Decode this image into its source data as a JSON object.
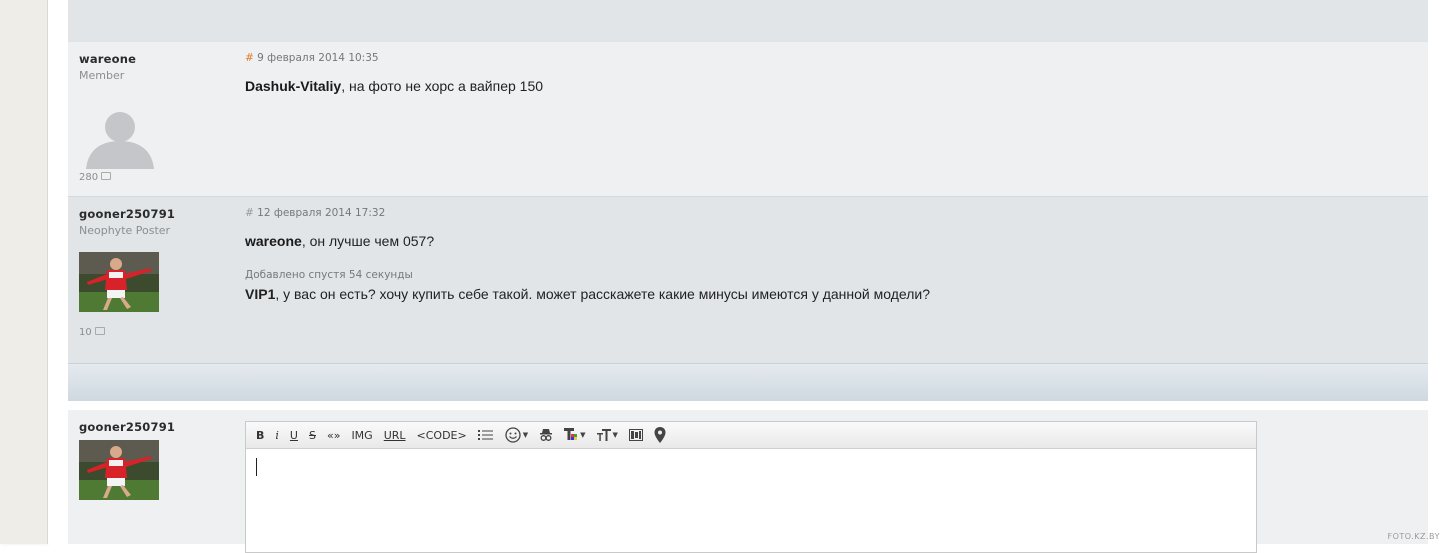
{
  "posts": [
    {
      "username": "wareone",
      "rank": "Member",
      "message_count": "280",
      "date": "9 февраля 2014 10:35",
      "quote_name": "Dashuk-Vitaliy",
      "text": ", на фото не хорс а вайпер 150"
    },
    {
      "username": "gooner250791",
      "rank": "Neophyte Poster",
      "message_count": "10",
      "date": "12 февраля 2014 17:32",
      "quote_name": "wareone",
      "text": ", он лучше чем 057?",
      "added_label": "Добавлено спустя 54 секунды",
      "quote_name2": "VIP1",
      "text2": ", у вас он есть? хочу купить себе такой. может расскажете какие минусы имеются у данной модели?"
    }
  ],
  "hash_symbol": "#",
  "reply": {
    "username": "gooner250791",
    "toolbar": {
      "bold": "B",
      "italic": "i",
      "underline": "U",
      "strike": "S",
      "quote": "«»",
      "img": "IMG",
      "url": "URL",
      "code": "<CODE>"
    }
  },
  "watermark": "FOTO.KZ.BY",
  "colors": {
    "hash_accent": "#e07b2a",
    "post_bg_light": "#eff0f2",
    "post_bg_dark": "#e2e5e8"
  },
  "icons": [
    "list-icon",
    "smiley-icon",
    "spy-icon",
    "text-color-icon",
    "text-size-icon",
    "media-icon",
    "map-pin-icon"
  ]
}
